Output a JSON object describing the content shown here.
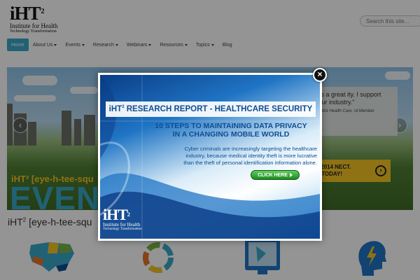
{
  "header": {
    "logo_mark": "iHT",
    "logo_sup": "2",
    "logo_line1": "Institute for Health",
    "logo_line2": "Technology Transformation",
    "search_placeholder": "Search this site..."
  },
  "nav": {
    "items": [
      {
        "label": "Home",
        "active": true,
        "dropdown": false
      },
      {
        "label": "About Us",
        "active": false,
        "dropdown": true
      },
      {
        "label": "Events",
        "active": false,
        "dropdown": true
      },
      {
        "label": "Research",
        "active": false,
        "dropdown": true
      },
      {
        "label": "Webinars",
        "active": false,
        "dropdown": true
      },
      {
        "label": "Resources",
        "active": false,
        "dropdown": true
      },
      {
        "label": "Topics",
        "active": false,
        "dropdown": true
      },
      {
        "label": "Blog",
        "active": false,
        "dropdown": false
      }
    ],
    "active_color": "#3aa7c9"
  },
  "hero": {
    "quote_text": "ace was a great ity. I support the in our industry.\"",
    "quote_author": "O CIO, Baptist Health Care, rd Member",
    "event_text": "ULY 22-23, 2014 NECT. REGISTER TODAY!",
    "tag_text": "iHT² [eye-h-tee-squ",
    "big_text": "EVEN",
    "prev_icon": "chevron-left-icon",
    "next_icon": "chevron-right-icon",
    "banner_color": "#f5c523"
  },
  "site_tag": {
    "text": "iHT",
    "sup": "2",
    "rest": " [eye-h-tee-squ"
  },
  "features": [
    {
      "icon": "us-map-icon"
    },
    {
      "icon": "cycle-icon"
    },
    {
      "icon": "tablet-icon"
    },
    {
      "icon": "head-lightning-icon"
    }
  ],
  "modal": {
    "report_title": "iHT",
    "report_sup": "2",
    "report_rest": " RESEARCH REPORT - HEALTHCARE SECURITY",
    "headline_line1": "10 STEPS TO MAINTAINING DATA PRIVACY",
    "headline_line2": "IN A CHANGING MOBILE WORLD",
    "body_line1": "Cyber criminals are increasingly targeting the healthcare",
    "body_line2": "industry, because medical identity theft is more lucrative",
    "body_line3": "than the theft of personal identification information alone.",
    "cta_label": "CLICK HERE",
    "logo_mark": "iHT",
    "logo_sup": "2",
    "logo_line1": "Institute for Health",
    "logo_line2": "Technology Transformation",
    "close_icon": "close-icon",
    "close_glyph": "×",
    "title_color": "#0e4d92"
  }
}
